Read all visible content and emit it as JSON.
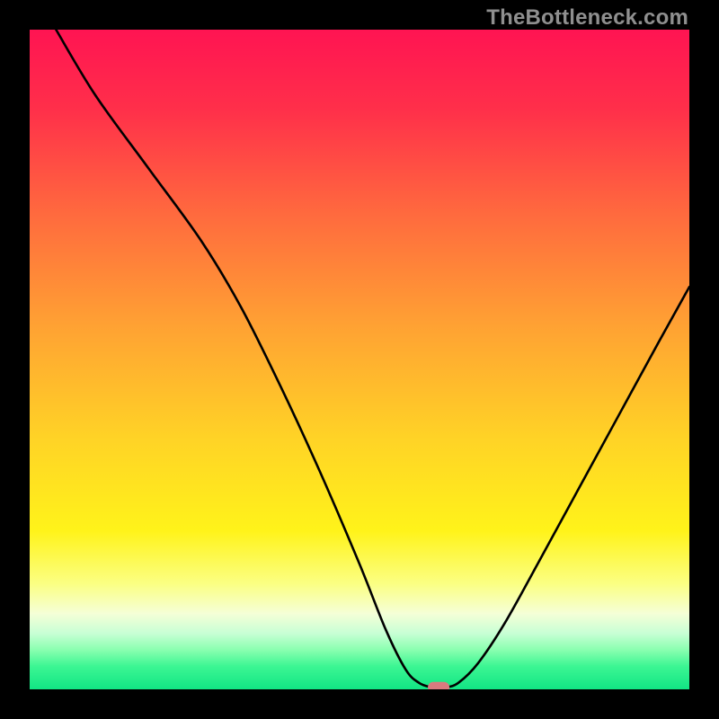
{
  "watermark": "TheBottleneck.com",
  "chart_data": {
    "type": "line",
    "title": "",
    "xlabel": "",
    "ylabel": "",
    "xlim": [
      0,
      100
    ],
    "ylim": [
      0,
      100
    ],
    "background_gradient_stops": [
      {
        "offset": 0.0,
        "color": "#ff1452"
      },
      {
        "offset": 0.12,
        "color": "#ff2f4a"
      },
      {
        "offset": 0.28,
        "color": "#ff6a3e"
      },
      {
        "offset": 0.45,
        "color": "#ffa233"
      },
      {
        "offset": 0.62,
        "color": "#ffd326"
      },
      {
        "offset": 0.76,
        "color": "#fff31a"
      },
      {
        "offset": 0.84,
        "color": "#fbff83"
      },
      {
        "offset": 0.885,
        "color": "#f5ffd7"
      },
      {
        "offset": 0.915,
        "color": "#c8ffd5"
      },
      {
        "offset": 0.94,
        "color": "#8affb0"
      },
      {
        "offset": 0.965,
        "color": "#3cf693"
      },
      {
        "offset": 1.0,
        "color": "#12e584"
      }
    ],
    "series": [
      {
        "name": "bottleneck-curve",
        "x": [
          4,
          10,
          18,
          26,
          32,
          38,
          44,
          50,
          54,
          57,
          59,
          61,
          63,
          65,
          68,
          72,
          77,
          83,
          89,
          95,
          100
        ],
        "y": [
          100,
          90,
          79,
          68,
          58,
          46,
          33,
          19,
          9,
          3,
          1,
          0.3,
          0.3,
          1,
          4,
          10,
          19,
          30,
          41,
          52,
          61
        ]
      }
    ],
    "marker": {
      "x": 62,
      "y": 0.3,
      "color": "#d97a7f"
    }
  }
}
